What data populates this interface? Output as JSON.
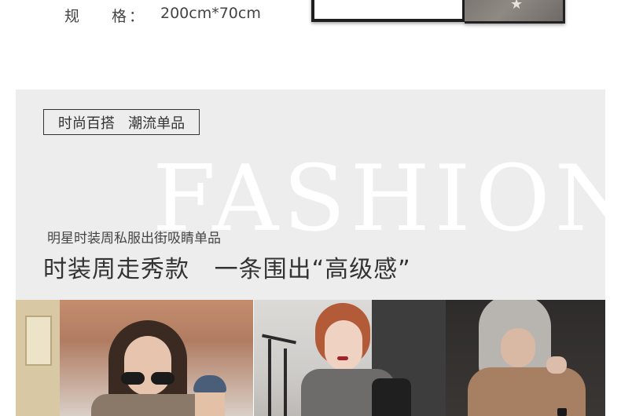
{
  "spec": {
    "label_char1": "规",
    "label_char2": "格",
    "colon": "：",
    "value": "200cm*70cm"
  },
  "banner": {
    "tagline": "时尚百搭   潮流单品",
    "watermark": "FASHION",
    "subtitle": "明星时装周私服出街吸睛单品",
    "headline": "时装周走秀款   一条围出“高级感”"
  },
  "colors": {
    "banner_bg": "#ededed",
    "text_dark": "#333333",
    "watermark": "#ffffff"
  },
  "icons": {
    "swatch_star": "★"
  }
}
